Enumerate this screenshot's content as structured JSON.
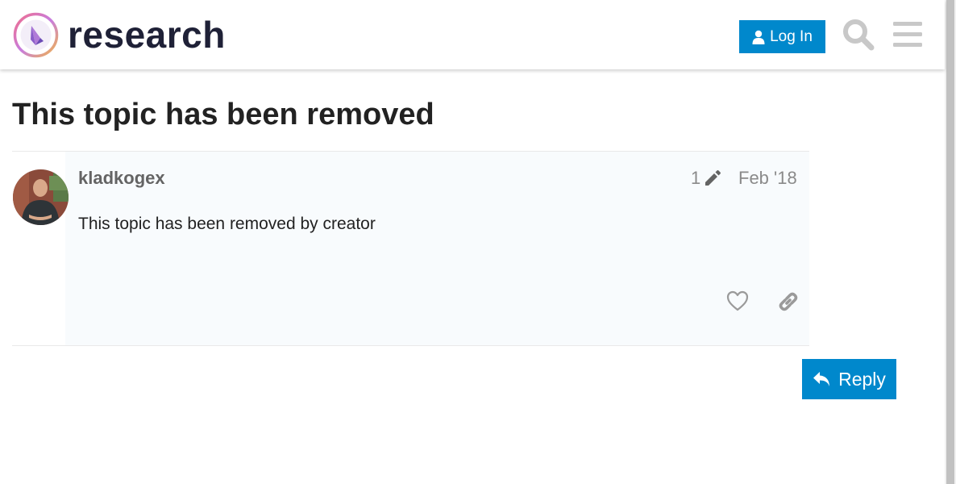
{
  "header": {
    "site_name": "research",
    "login_label": "Log In",
    "icons": [
      "logo-icon",
      "user-icon",
      "search-icon",
      "hamburger-menu-icon"
    ]
  },
  "topic": {
    "title": "This topic has been removed"
  },
  "post": {
    "username": "kladkogex",
    "edit_count": "1",
    "date": "Feb '18",
    "body": "This topic has been removed by creator",
    "icons": [
      "pencil-icon",
      "heart-icon",
      "link-icon"
    ]
  },
  "actions": {
    "reply_label": "Reply",
    "reply_icon": "reply-arrow-icon"
  },
  "colors": {
    "accent": "#0088cc",
    "header_text": "#1f2137",
    "muted": "#8a8a8a",
    "icon_gray": "#c8c8c8"
  }
}
